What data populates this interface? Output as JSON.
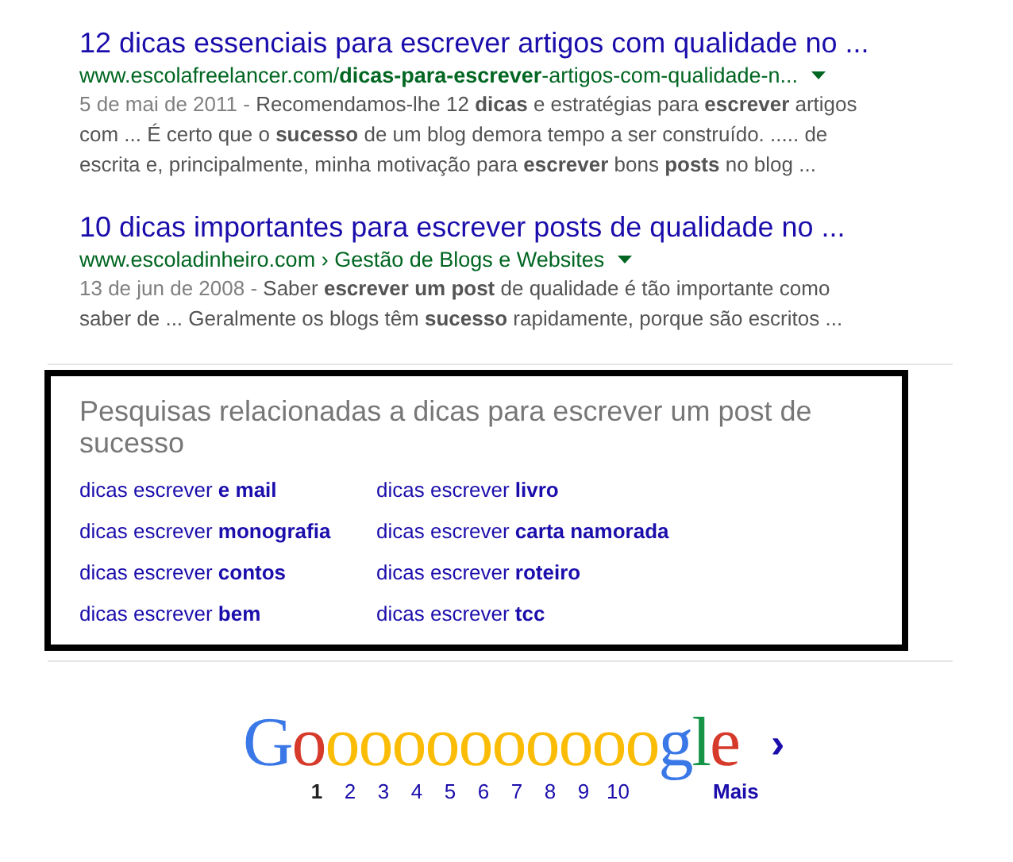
{
  "results": [
    {
      "title": "12 dicas essenciais para escrever artigos com qualidade no ...",
      "url": "www.escolafreelancer.com/**dicas-para-escrever**-artigos-com-qualidade-n...",
      "date": "5 de mai de 2011 - ",
      "snippet": "Recomendamos-lhe 12 **dicas** e estratégias para **escrever** artigos com ... É certo que o **sucesso** de um blog demora tempo a ser construído. ..... de escrita e, principalmente, minha motivação para **escrever** bons **posts** no blog ..."
    },
    {
      "title": "10 dicas importantes para escrever posts de qualidade no ...",
      "url": "www.escoladinheiro.com › Gestão de Blogs e Websites",
      "date": "13 de jun de 2008 - ",
      "snippet": "Saber **escrever um post** de qualidade é tão importante como saber de ... Geralmente os blogs têm **sucesso** rapidamente, porque são escritos ..."
    }
  ],
  "related": {
    "heading": "Pesquisas relacionadas a dicas para escrever um post de sucesso",
    "columns": [
      [
        "dicas escrever **e mail**",
        "dicas escrever **monografia**",
        "dicas escrever **contos**",
        "dicas escrever **bem**"
      ],
      [
        "dicas escrever **livro**",
        "dicas escrever **carta namorada**",
        "dicas escrever **roteiro**",
        "dicas escrever **tcc**"
      ]
    ]
  },
  "pagination": {
    "logo": [
      {
        "text": "G",
        "color": "#3b78e7"
      },
      {
        "text": "o",
        "color": "#d63a2a"
      },
      {
        "text": "oooooooooo",
        "color": "#fbbc05"
      },
      {
        "text": "g",
        "color": "#3b78e7"
      },
      {
        "text": "l",
        "color": "#159447"
      },
      {
        "text": "e",
        "color": "#d63a2a"
      }
    ],
    "next": "›",
    "pages": [
      {
        "label": "1",
        "selected": true
      },
      {
        "label": "2",
        "selected": false
      },
      {
        "label": "3",
        "selected": false
      },
      {
        "label": "4",
        "selected": false
      },
      {
        "label": "5",
        "selected": false
      },
      {
        "label": "6",
        "selected": false
      },
      {
        "label": "7",
        "selected": false
      },
      {
        "label": "8",
        "selected": false
      },
      {
        "label": "9",
        "selected": false
      },
      {
        "label": "10",
        "selected": false
      }
    ],
    "more": "Mais"
  }
}
